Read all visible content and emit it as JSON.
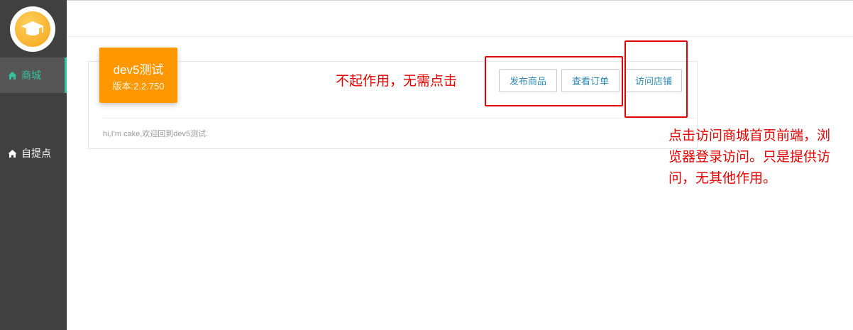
{
  "sidebar": {
    "items": [
      {
        "label": "商城",
        "icon": "home-icon",
        "active": true
      },
      {
        "label": "自提点",
        "icon": "home-icon",
        "active": false
      }
    ],
    "accent_color": "#2ec7a1",
    "logo_icon": "graduation-cap-icon"
  },
  "card": {
    "title": "dev5测试",
    "version": "版本:2.2.750",
    "welcome": "hi,I'm cake,欢迎回到dev5测试.",
    "badge_color": "#ff9800"
  },
  "actions": {
    "publish_label": "发布商品",
    "orders_label": "查看订单",
    "visit_label": "访问店铺"
  },
  "annotations": {
    "note_left": "不起作用，无需点击",
    "note_right_lines": [
      "点击访问商城首页前端，浏",
      "览器登录访问。只是提供访",
      "问，无其他作用。"
    ],
    "color": "#e30000"
  }
}
